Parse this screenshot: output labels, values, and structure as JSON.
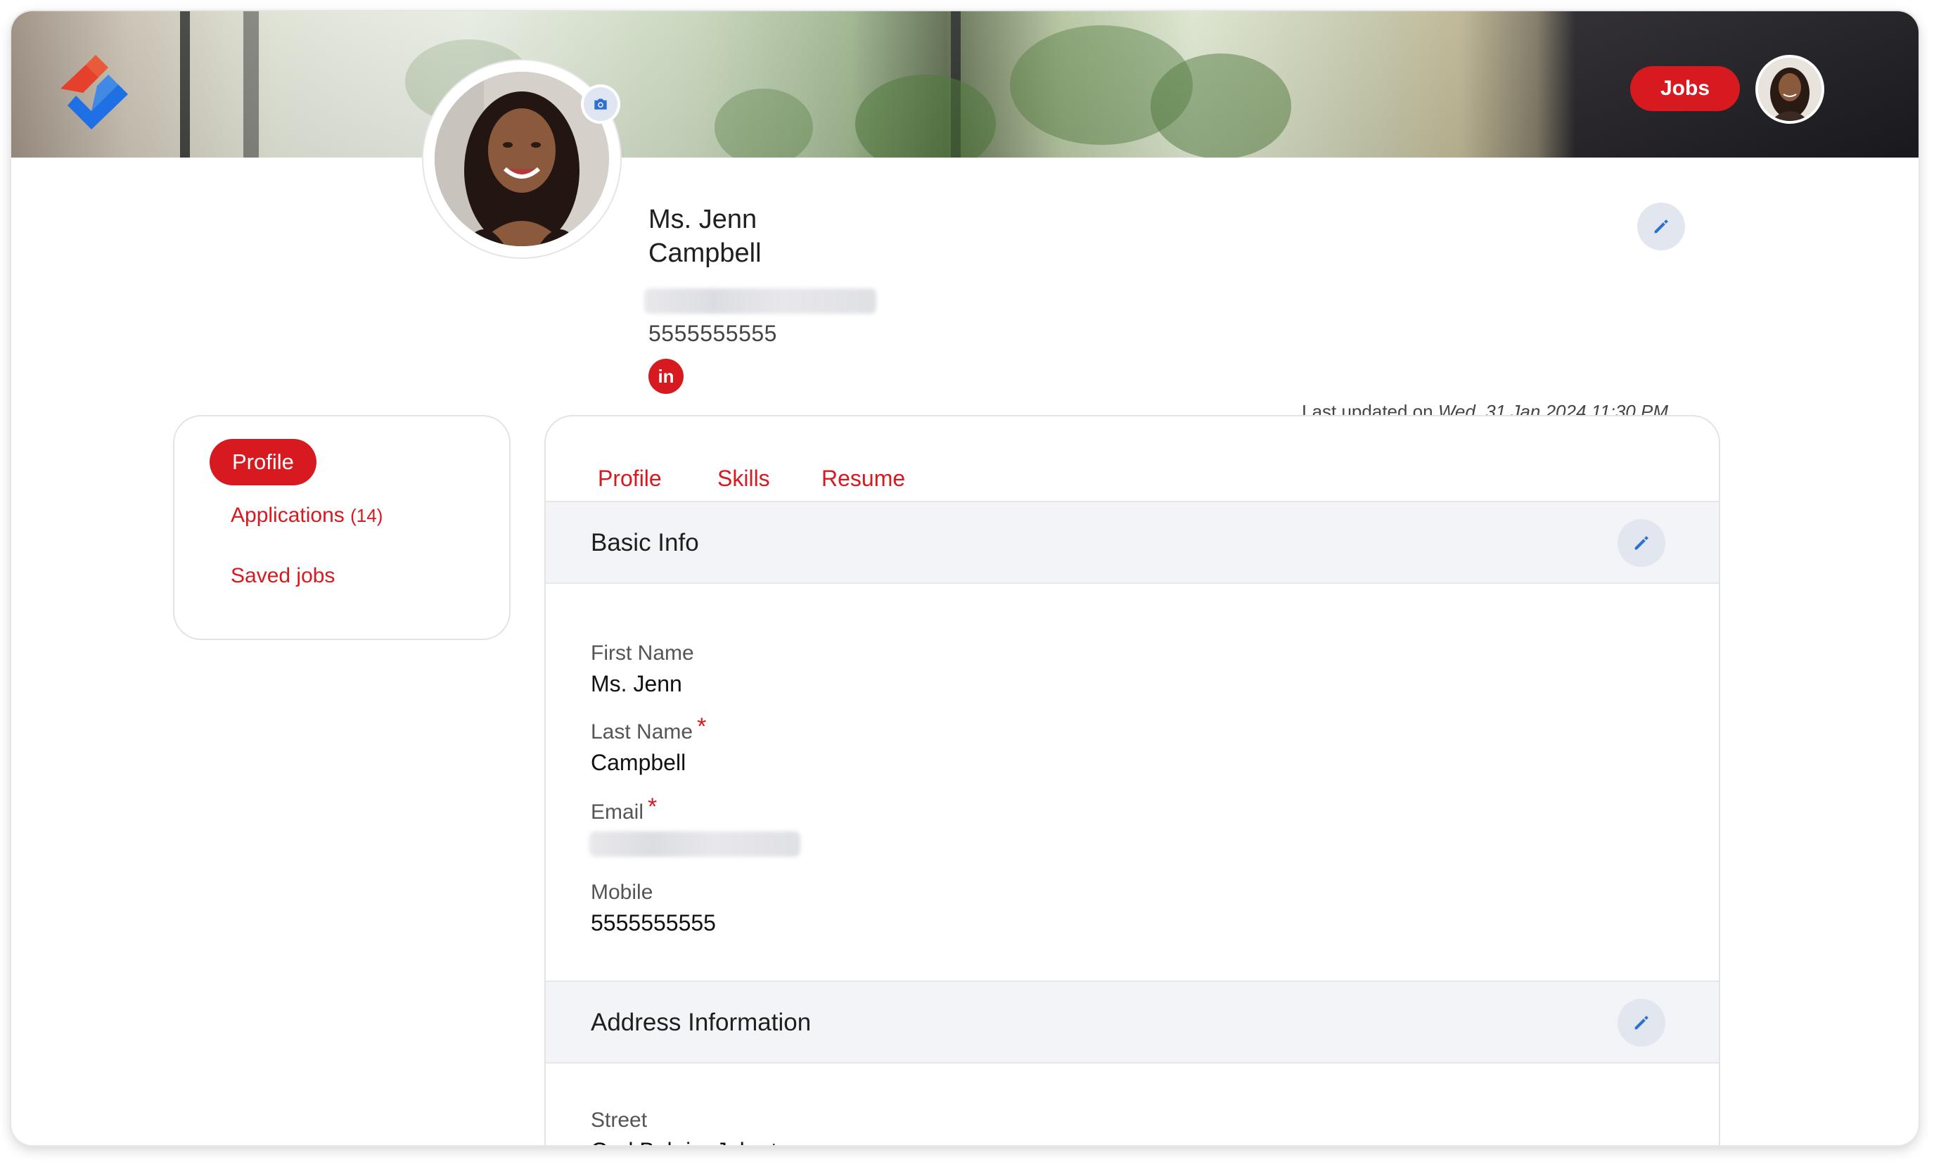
{
  "header": {
    "jobs_label": "Jobs",
    "logo_icon": "brand-logo-icon",
    "avatar_icon": "user-avatar"
  },
  "profile": {
    "first_line": "Ms. Jenn",
    "second_line": "Campbell",
    "phone": "5555555555",
    "linkedin_label": "in",
    "last_updated_prefix": "Last updated on",
    "last_updated_value": "Wed, 31 Jan 2024 11:30 PM"
  },
  "sidebar": {
    "items": [
      {
        "label": "Profile"
      },
      {
        "label": "Applications",
        "count": "(14)"
      },
      {
        "label": "Saved jobs"
      }
    ]
  },
  "main": {
    "tabs": [
      {
        "label": "Profile"
      },
      {
        "label": "Skills"
      },
      {
        "label": "Resume"
      }
    ],
    "basic_info": {
      "title": "Basic Info",
      "first_name_label": "First Name",
      "first_name": "Ms. Jenn",
      "last_name_label": "Last Name",
      "last_name": "Campbell",
      "email_label": "Email",
      "mobile_label": "Mobile",
      "mobile": "5555555555",
      "required_mark": "*"
    },
    "address": {
      "title": "Address Information",
      "street_label": "Street",
      "street": "Ged Bakrie, Jakarta"
    }
  },
  "colors": {
    "accent": "#d71920",
    "edit_icon": "#2f6fcf",
    "section_bg": "#f3f4f8"
  }
}
